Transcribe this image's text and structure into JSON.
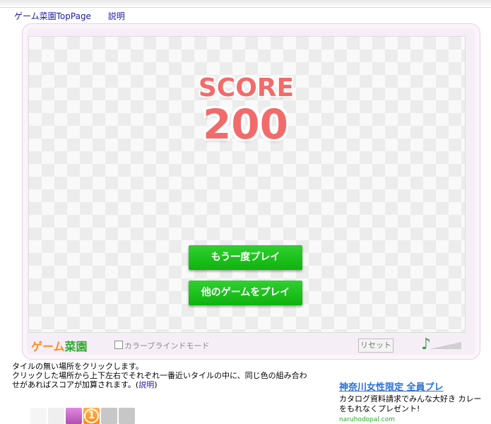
{
  "nav": {
    "top_link": "ゲーム菜園TopPage",
    "help_link": "説明"
  },
  "game": {
    "score_label": "SCORE",
    "score_value": "200",
    "replay_button": "もう一度プレイ",
    "other_games_button": "他のゲームをプレイ",
    "logo_part1": "ゲーム",
    "logo_part2": "菜園",
    "colorblind_mode": "カラーブラインドモード",
    "reset_button": "リセット"
  },
  "instructions": {
    "line1": "タイルの無い場所をクリックします。",
    "line2": "クリックした場所から上下左右でそれぞれ一番近いタイルの中に、同じ色の組み合わせがあればスコアが加算されます。",
    "link_open": "(",
    "link": "説明",
    "link_close": ")"
  },
  "ad": {
    "title": "神奈川女性限定 全員プレ",
    "text": "カタログ資料請求でみんな大好き カレーをもれなくプレゼント!",
    "url": "naruhodopal.com"
  },
  "tiles": {
    "numbered_tile": "1"
  },
  "colors": {
    "score": "#f26b6b",
    "button": "#10b410",
    "link": "#1a1aa8"
  }
}
